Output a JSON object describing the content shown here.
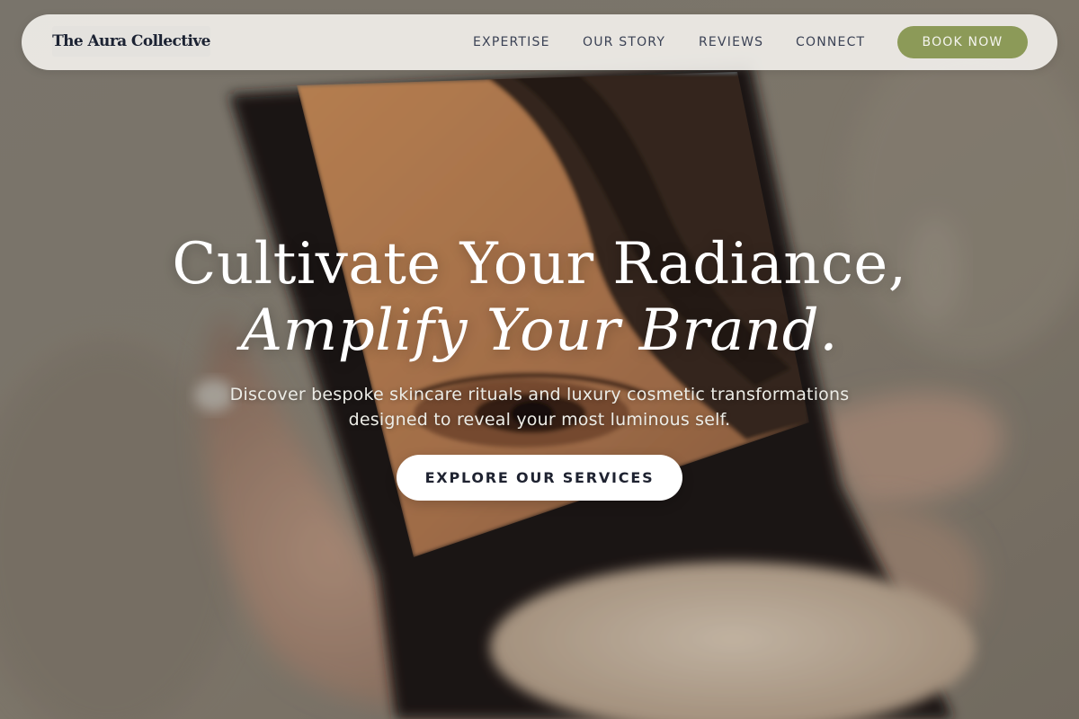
{
  "brand": {
    "name": "The Aura Collective"
  },
  "nav": {
    "links": [
      "EXPERTISE",
      "OUR STORY",
      "REVIEWS",
      "CONNECT"
    ],
    "cta_label": "BOOK NOW"
  },
  "hero": {
    "headline_line1": "Cultivate Your Radiance,",
    "headline_line2": "Amplify Your Brand.",
    "subtext": "Discover bespoke skincare rituals and luxury cosmetic transformations designed to reveal your most luminous self.",
    "cta_label": "EXPLORE OUR SERVICES"
  },
  "colors": {
    "accent": "#8c9a58",
    "nav_text": "#3b4255",
    "brand_text": "#1c2333",
    "hero_text": "#ffffff"
  }
}
